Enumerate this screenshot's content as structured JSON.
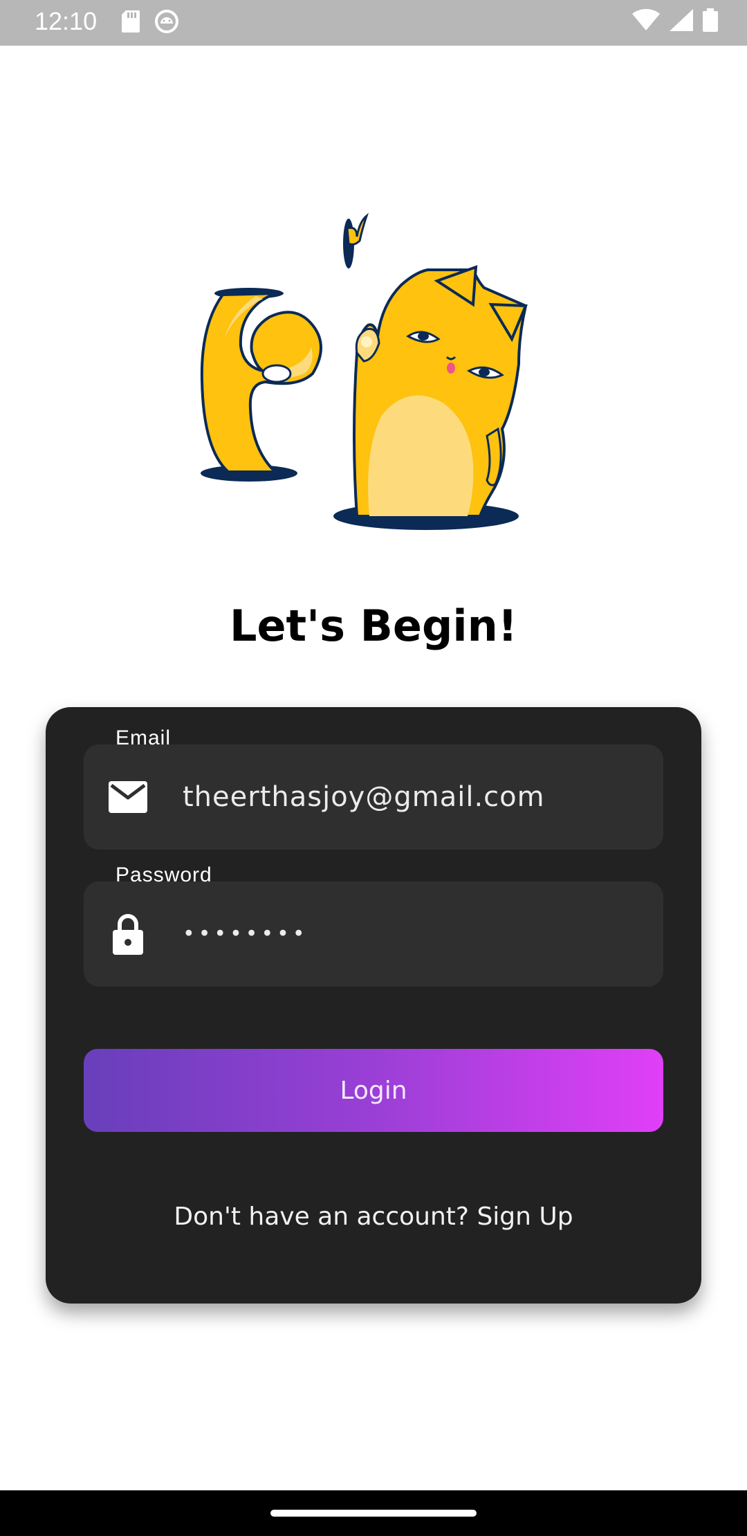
{
  "status_bar": {
    "time": "12:10",
    "left_icons": [
      "sd-card-icon",
      "android-debug-icon"
    ],
    "right_icons": [
      "wifi-icon",
      "signal-icon",
      "battery-icon"
    ]
  },
  "illustration": {
    "name": "yellow-cat-illustration"
  },
  "title": "Let's Begin!",
  "form": {
    "email": {
      "label": "Email",
      "value": "theerthasjoy@gmail.com",
      "icon": "mail-icon"
    },
    "password": {
      "label": "Password",
      "value": "••••••••",
      "icon": "lock-icon"
    },
    "login_label": "Login",
    "signup_text": "Don't have an account? Sign Up"
  },
  "colors": {
    "card_bg": "#222222",
    "field_bg": "#2f2f2f",
    "gradient_start": "#683fbb",
    "gradient_end": "#e03ff7",
    "cat_yellow": "#fec20f",
    "cat_belly": "#fddb7d",
    "outline_navy": "#0b2a55"
  }
}
